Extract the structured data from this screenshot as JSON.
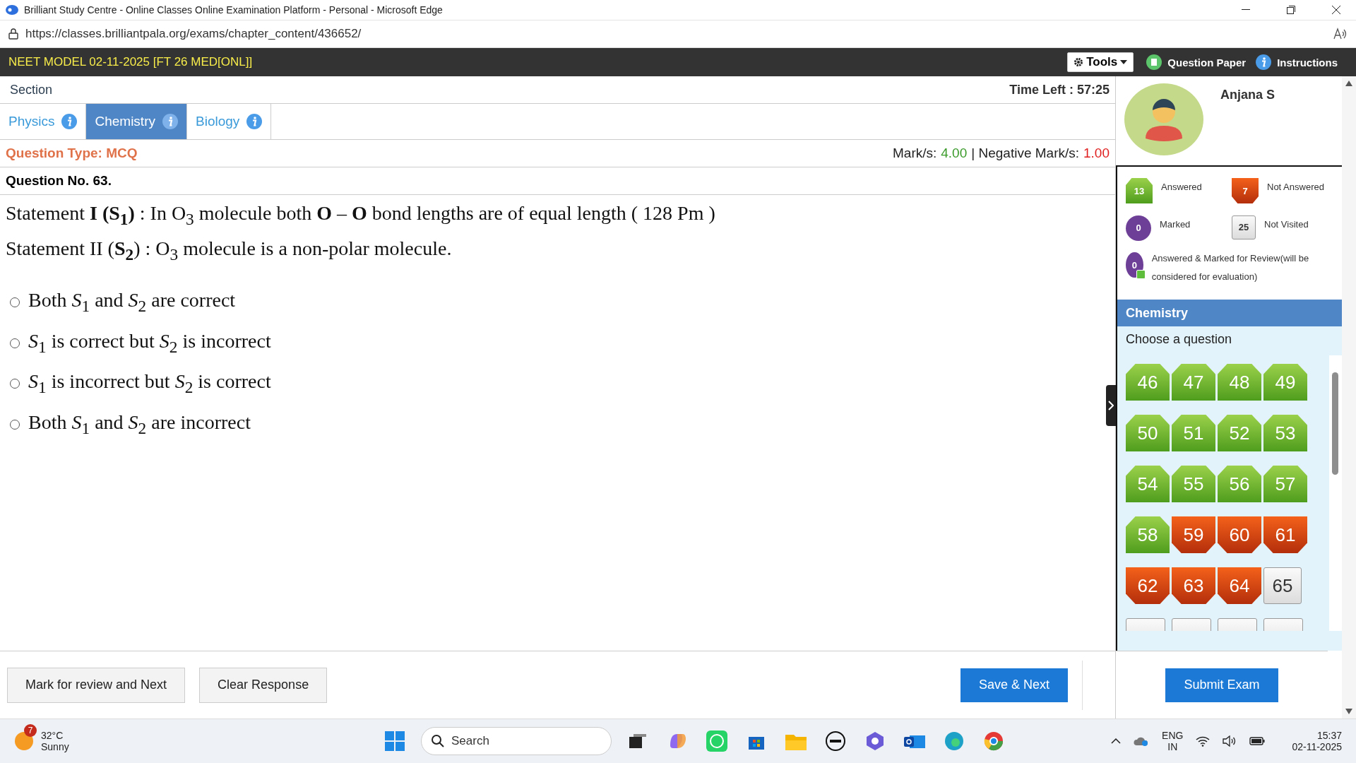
{
  "browser": {
    "title": "Brilliant Study Centre - Online Classes Online Examination Platform - Personal - Microsoft Edge",
    "url": "https://classes.brilliantpala.org/exams/chapter_content/436652/"
  },
  "exam": {
    "title": "NEET MODEL 02-11-2025 [FT 26 MED[ONL]]",
    "tools": "Tools",
    "question_paper": "Question Paper",
    "instructions": "Instructions"
  },
  "section": {
    "label": "Section",
    "time_label": "Time Left :",
    "time": "57:25"
  },
  "tabs": [
    {
      "label": "Physics",
      "selected": false
    },
    {
      "label": "Chemistry",
      "selected": true
    },
    {
      "label": "Biology",
      "selected": false
    }
  ],
  "question": {
    "type": "Question Type: MCQ",
    "marks_label": "Mark/s:",
    "marks": "4.00",
    "negative_label": "| Negative Mark/s:",
    "negative": "1.00",
    "number": "Question No. 63.",
    "statements": [
      "Statement **I (S$_{1}$)** : In O$_{3}$ molecule both **O** – **O** bond lengths are of equal length ( 128 Pm )",
      "Statement II (**S$_{2}$**) : O$_{3}$ molecule is a non-polar molecule."
    ],
    "options": [
      {
        "text": "Both *S*$_{1}$ and *S*$_{2}$ are correct",
        "selected": false
      },
      {
        "text": "*S*$_{1}$ is correct but *S*$_{2}$ is incorrect",
        "selected": false
      },
      {
        "text": "*S*$_{1}$ is incorrect but *S*$_{2}$ is correct",
        "selected": false
      },
      {
        "text": "Both *S*$_{1}$ and *S*$_{2}$ are incorrect",
        "selected": false
      }
    ]
  },
  "actions": {
    "mark_review": "Mark for review and Next",
    "clear": "Clear Response",
    "save_next": "Save & Next",
    "submit": "Submit Exam"
  },
  "profile": {
    "name": "Anjana S"
  },
  "legend": [
    {
      "kind": "answered",
      "count": "13",
      "label": "Answered"
    },
    {
      "kind": "not_answered",
      "count": "7",
      "label": "Not Answered"
    },
    {
      "kind": "marked",
      "count": "0",
      "label": "Marked"
    },
    {
      "kind": "not_visited",
      "count": "25",
      "label": "Not Visited"
    },
    {
      "kind": "answered_marked",
      "count": "0",
      "label": "Answered & Marked for Review(will be considered for evaluation)"
    }
  ],
  "palette": {
    "section": "Chemistry",
    "prompt": "Choose a question",
    "questions": [
      {
        "number": "46",
        "kind": "answered"
      },
      {
        "number": "47",
        "kind": "answered"
      },
      {
        "number": "48",
        "kind": "answered"
      },
      {
        "number": "49",
        "kind": "answered"
      },
      {
        "number": "50",
        "kind": "answered"
      },
      {
        "number": "51",
        "kind": "answered"
      },
      {
        "number": "52",
        "kind": "answered"
      },
      {
        "number": "53",
        "kind": "answered"
      },
      {
        "number": "54",
        "kind": "answered"
      },
      {
        "number": "55",
        "kind": "answered"
      },
      {
        "number": "56",
        "kind": "answered"
      },
      {
        "number": "57",
        "kind": "answered"
      },
      {
        "number": "58",
        "kind": "answered"
      },
      {
        "number": "59",
        "kind": "not_answered"
      },
      {
        "number": "60",
        "kind": "not_answered"
      },
      {
        "number": "61",
        "kind": "not_answered"
      },
      {
        "number": "62",
        "kind": "not_answered"
      },
      {
        "number": "63",
        "kind": "not_answered"
      },
      {
        "number": "64",
        "kind": "not_answered"
      },
      {
        "number": "65",
        "kind": "not_visited"
      }
    ],
    "partly_hidden": [
      {
        "kind": "not_visited"
      },
      {
        "kind": "not_visited"
      },
      {
        "kind": "not_visited"
      },
      {
        "kind": "not_visited"
      }
    ]
  },
  "taskbar": {
    "weather_badge": "7",
    "temperature": "32°C",
    "condition": "Sunny",
    "search": "Search",
    "language": "ENG",
    "region": "IN",
    "time": "15:37",
    "date": "02-11-2025"
  }
}
